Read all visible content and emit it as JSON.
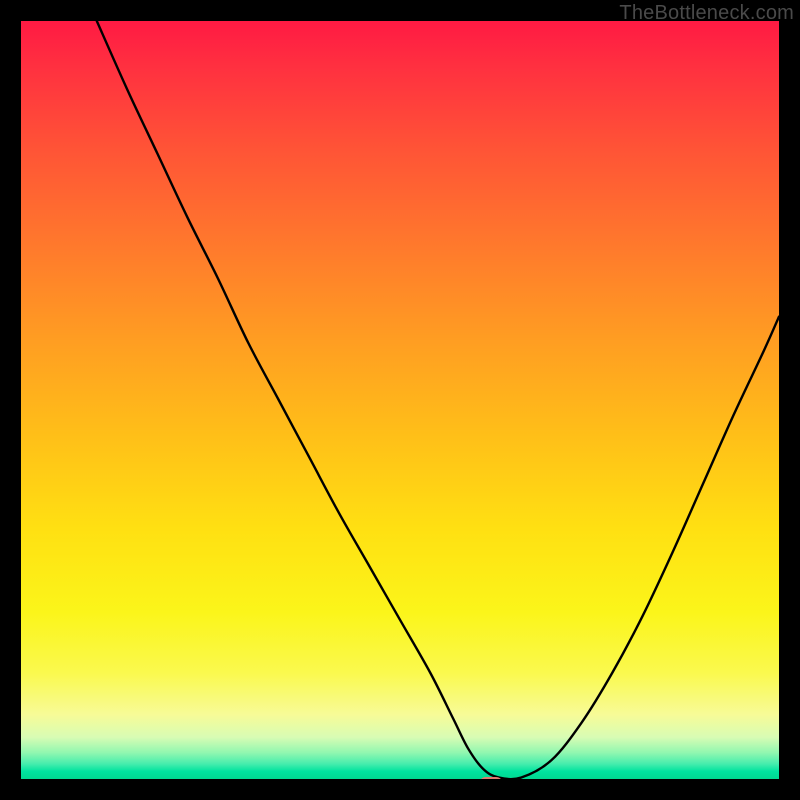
{
  "watermark": "TheBottleneck.com",
  "chart_data": {
    "type": "line",
    "title": "",
    "xlabel": "",
    "ylabel": "",
    "xlim": [
      0,
      100
    ],
    "ylim": [
      0,
      100
    ],
    "grid": false,
    "background_gradient": {
      "direction": "vertical",
      "stops": [
        {
          "pos": 0.0,
          "color": "#ff1a43"
        },
        {
          "pos": 0.06,
          "color": "#ff3040"
        },
        {
          "pos": 0.17,
          "color": "#ff5436"
        },
        {
          "pos": 0.3,
          "color": "#ff7a2c"
        },
        {
          "pos": 0.42,
          "color": "#ff9d22"
        },
        {
          "pos": 0.55,
          "color": "#ffc018"
        },
        {
          "pos": 0.67,
          "color": "#ffe012"
        },
        {
          "pos": 0.78,
          "color": "#fbf51a"
        },
        {
          "pos": 0.86,
          "color": "#faf94e"
        },
        {
          "pos": 0.915,
          "color": "#f7fb97"
        },
        {
          "pos": 0.945,
          "color": "#d8fcb4"
        },
        {
          "pos": 0.965,
          "color": "#92f7b0"
        },
        {
          "pos": 0.98,
          "color": "#46edad"
        },
        {
          "pos": 0.99,
          "color": "#00e39f"
        },
        {
          "pos": 1.0,
          "color": "#00d890"
        }
      ]
    },
    "series": [
      {
        "name": "curve",
        "color": "#000000",
        "x": [
          10,
          14,
          18,
          22,
          26,
          30,
          34,
          38,
          42,
          46,
          50,
          54,
          57,
          59,
          61,
          63,
          66,
          70,
          74,
          78,
          82,
          86,
          90,
          94,
          98,
          100
        ],
        "y": [
          100,
          91,
          82.5,
          74,
          66,
          57.5,
          50,
          42.5,
          35,
          28,
          21,
          14,
          8,
          4,
          1.3,
          0.2,
          0.2,
          2.5,
          7.5,
          14,
          21.5,
          30,
          39,
          48,
          56.5,
          61
        ]
      }
    ],
    "marker": {
      "x": 62,
      "y": -0.6,
      "color": "#e17a6f"
    }
  }
}
